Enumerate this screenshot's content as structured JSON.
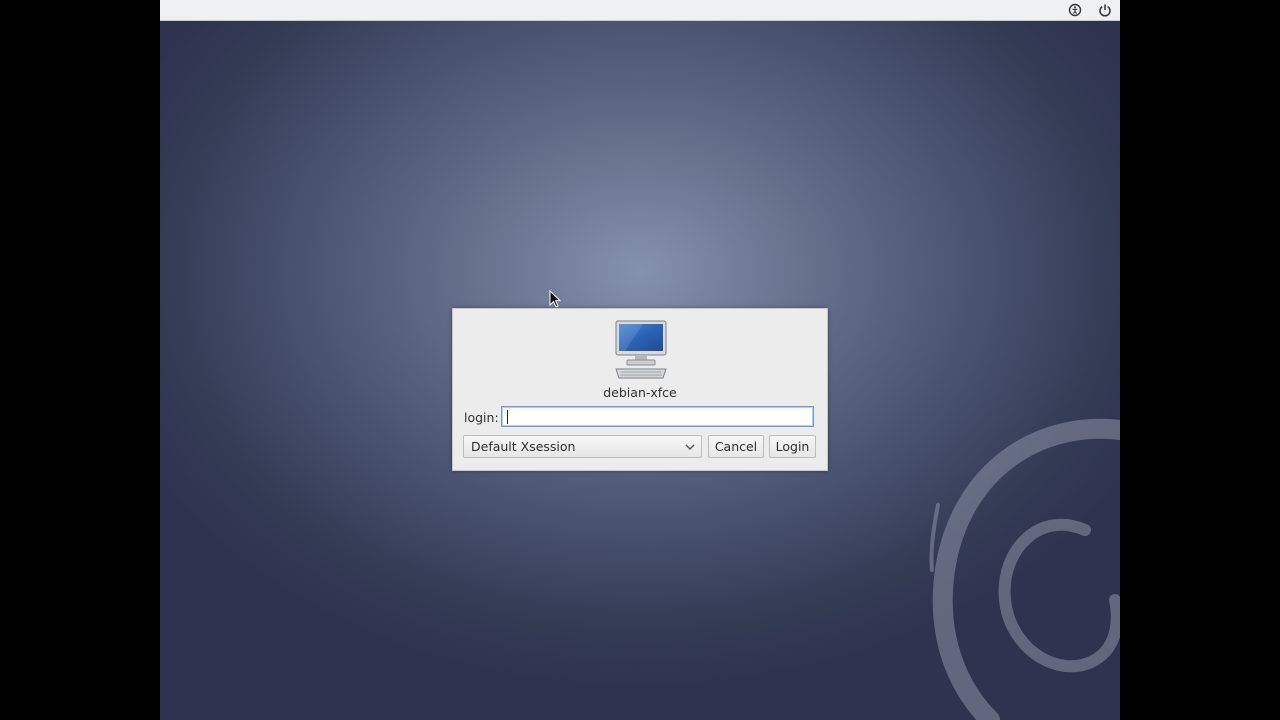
{
  "topbar": {
    "icons": [
      "accessibility-icon",
      "power-icon"
    ]
  },
  "dialog": {
    "hostname": "debian-xfce",
    "login_label": "login:",
    "login_value": "",
    "session_value": "Default Xsession",
    "cancel_label": "Cancel",
    "login_button_label": "Login"
  },
  "colors": {
    "accent": "#6d9bd6",
    "background": "#4a5371",
    "panel": "#eff0f1"
  }
}
